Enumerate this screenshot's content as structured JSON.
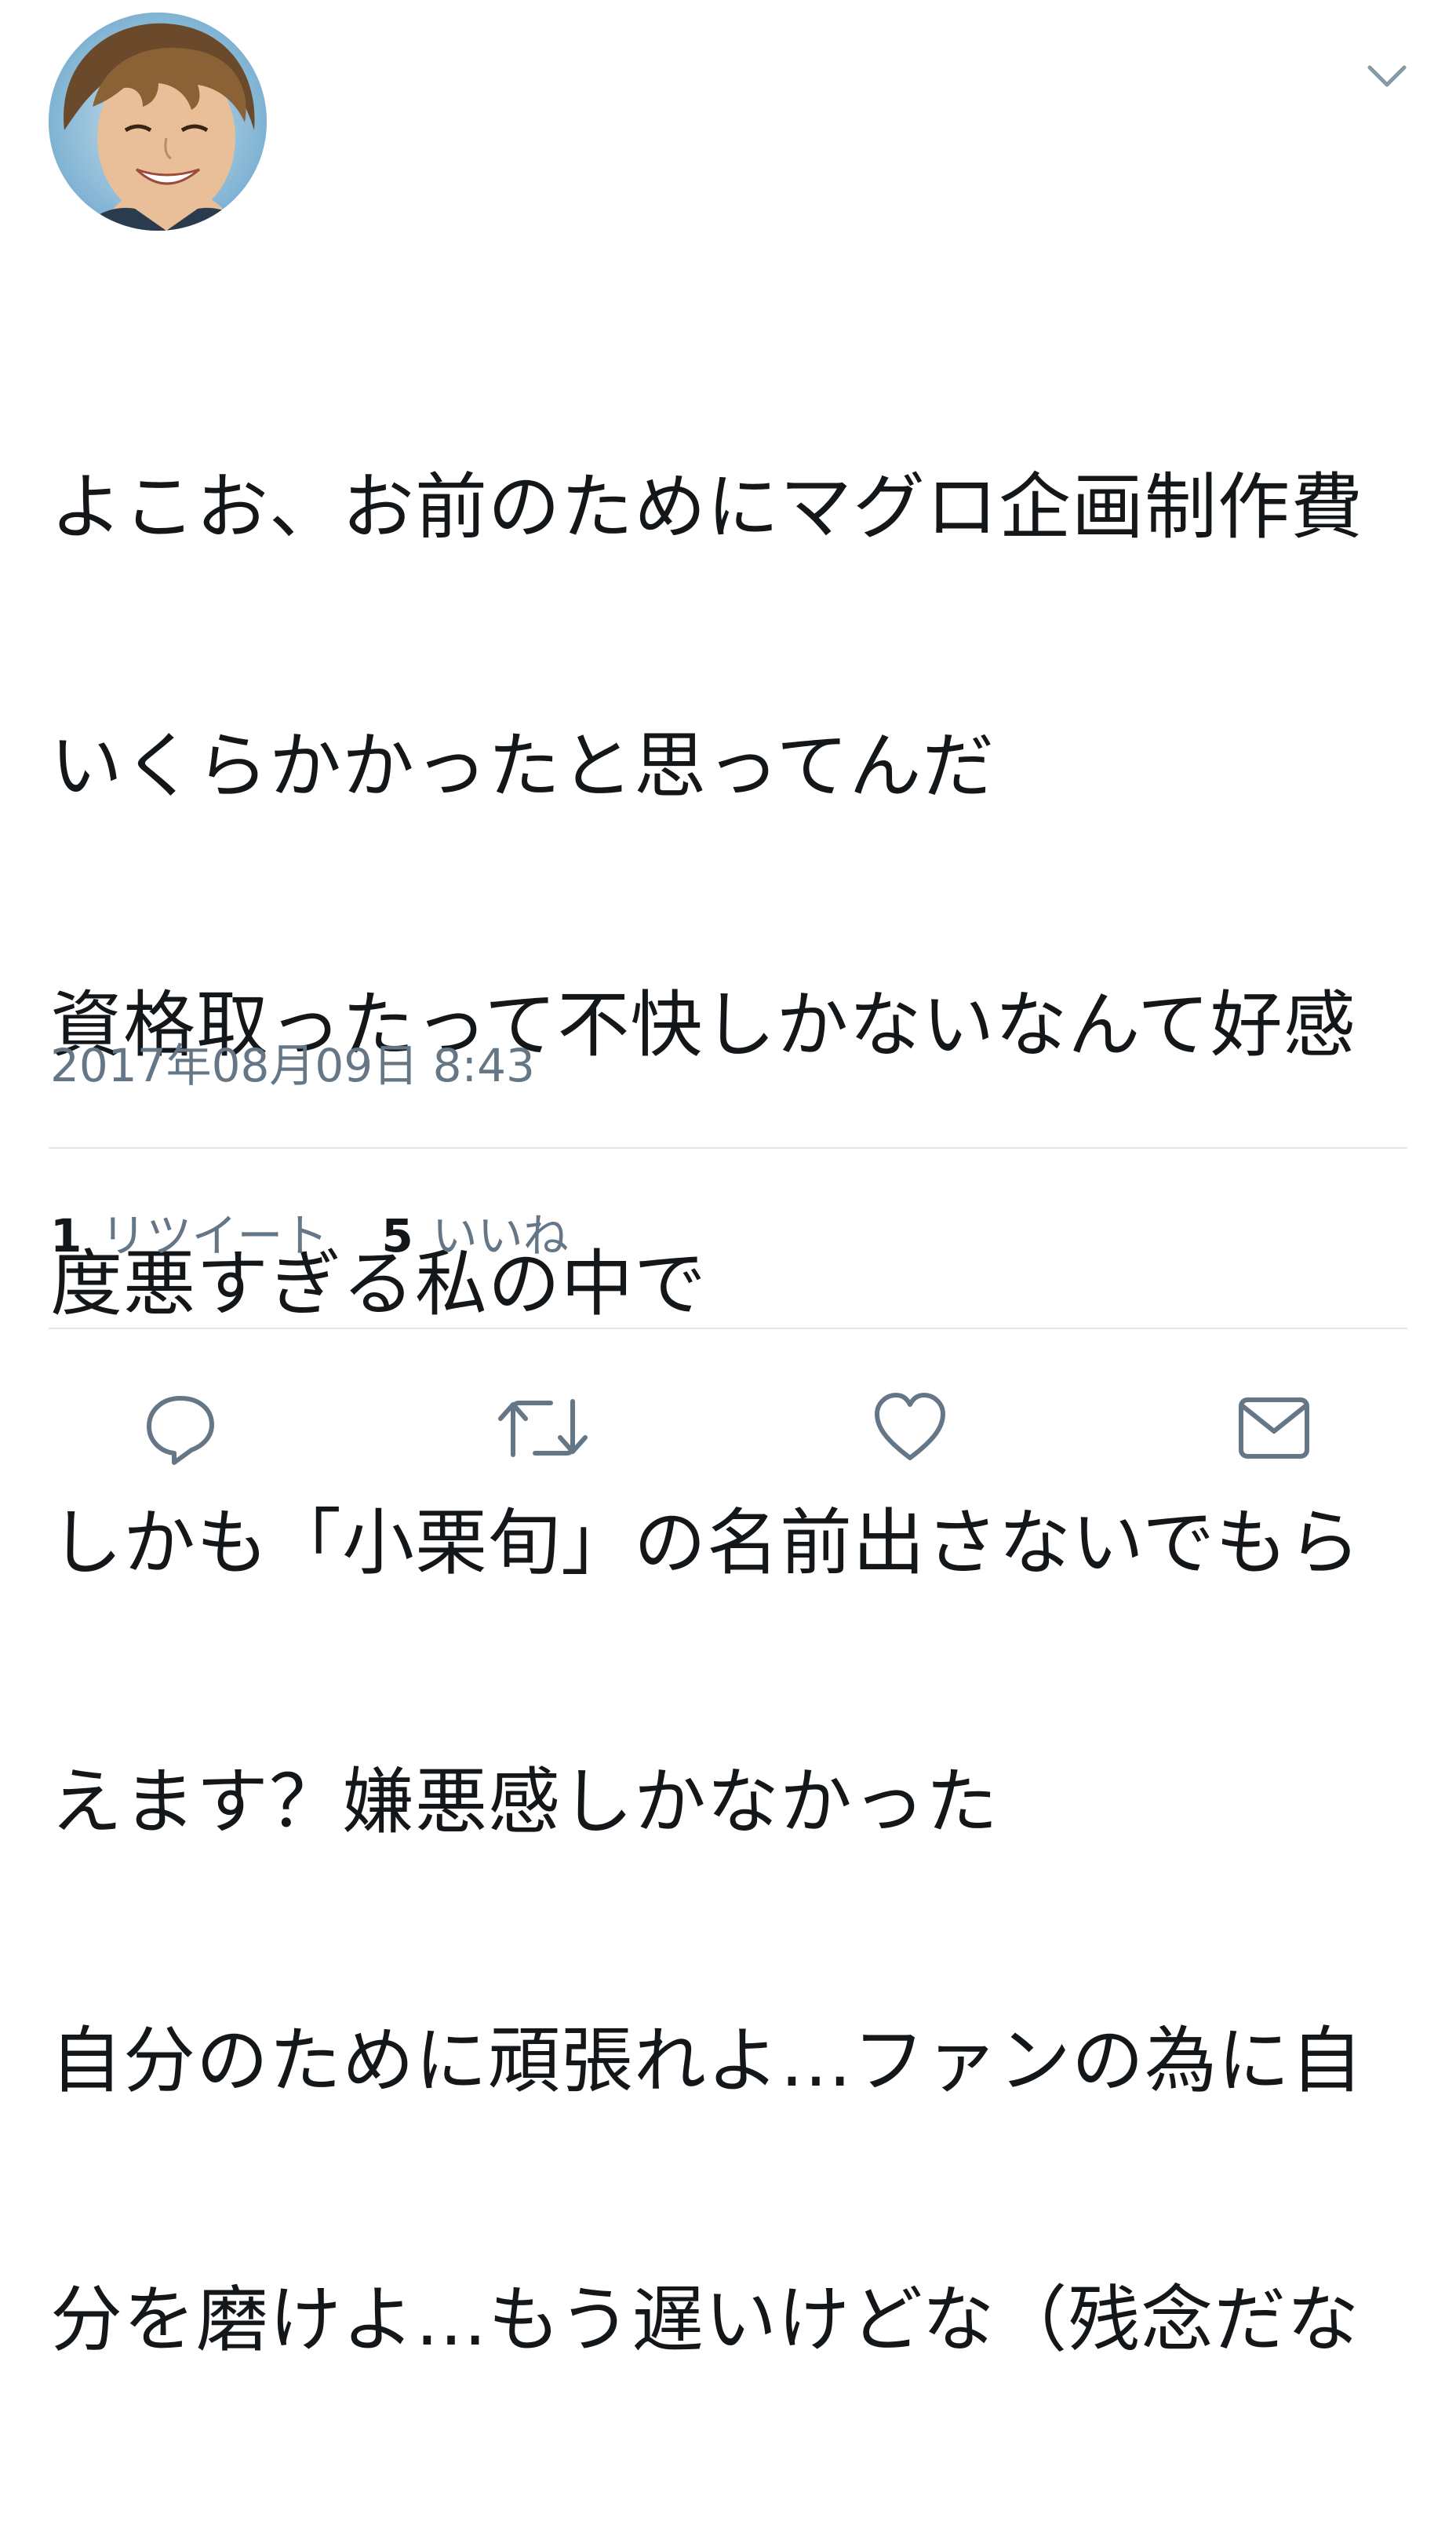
{
  "tweet": {
    "avatar_icon": "user-avatar-photo",
    "menu_icon": "chevron-down-icon",
    "lines": [
      "よこお、お前のためにマグロ企画制作費",
      "いくらかかったと思ってんだ",
      "資格取ったって不快しかないなんて好感",
      "度悪すぎる私の中で",
      "しかも「小栗旬」の名前出さないでもら",
      "えます？嫌悪感しかなかった",
      "自分のために頑張れよ…ファンの為に自",
      "分を磨けよ…もう遅いけどな（残念だな"
    ],
    "timestamp": "2017年08月09日 8:43",
    "stats": {
      "retweet_count": "1",
      "retweet_label": "リツイート",
      "like_count": "5",
      "like_label": "いいね"
    },
    "actions": {
      "reply_icon": "reply-icon",
      "retweet_icon": "retweet-icon",
      "like_icon": "heart-icon",
      "message_icon": "envelope-icon"
    },
    "colors": {
      "text": "#14171a",
      "secondary": "#657786",
      "divider": "#e1e8ed",
      "icon": "#657786"
    }
  }
}
